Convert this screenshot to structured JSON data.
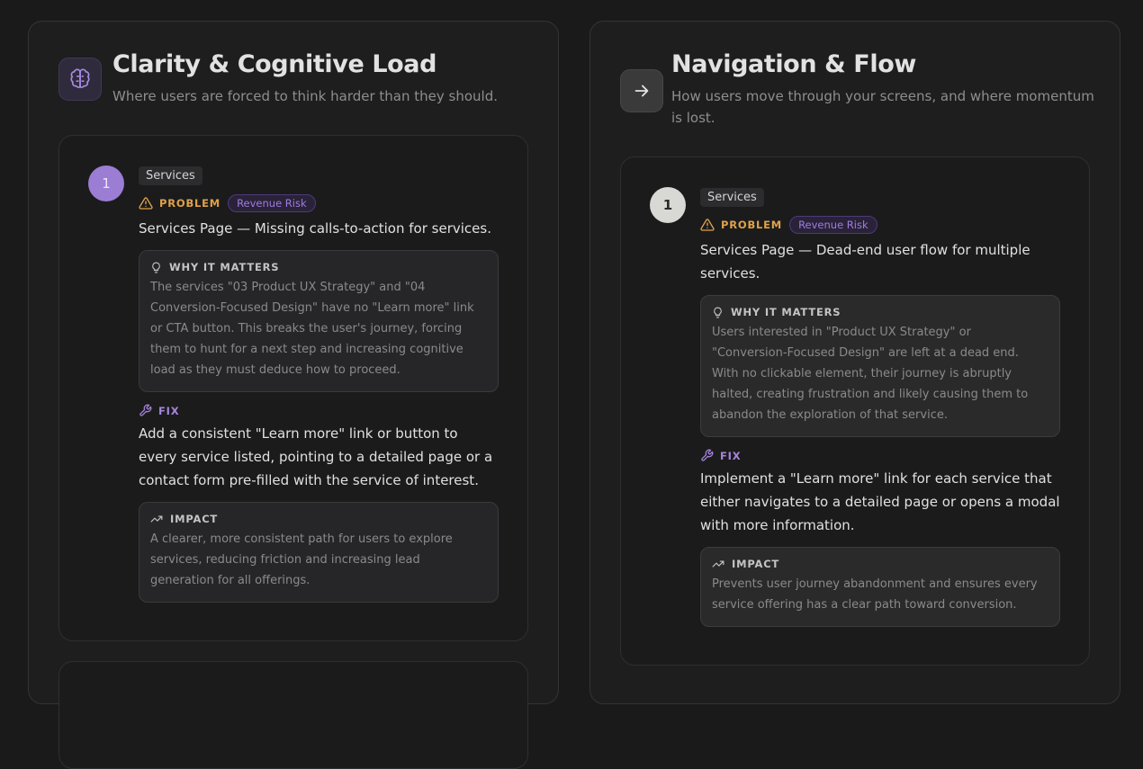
{
  "colors": {
    "accent_purple": "#9b7dd4",
    "problem_amber": "#e0a24a",
    "fix_purple": "#a586dc"
  },
  "categories": [
    {
      "icon": "brain-icon",
      "title": "Clarity & Cognitive Load",
      "subtitle": "Where users are forced to think harder than they should.",
      "issues": [
        {
          "number": "1",
          "tag": "Services",
          "problem_label": "PROBLEM",
          "risk_badge": "Revenue Risk",
          "problem": "Services Page — Missing calls-to-action for services.",
          "why_label": "WHY IT MATTERS",
          "why": "The services \"03 Product UX Strategy\" and \"04 Conversion-Focused Design\" have no \"Learn more\" link or CTA button. This breaks the user's journey, forcing them to hunt for a next step and increasing cognitive load as they must deduce how to proceed.",
          "fix_label": "FIX",
          "fix": "Add a consistent \"Learn more\" link or button to every service listed, pointing to a detailed page or a contact form pre-filled with the service of interest.",
          "impact_label": "IMPACT",
          "impact": "A clearer, more consistent path for users to explore services, reducing friction and increasing lead generation for all offerings."
        }
      ]
    },
    {
      "icon": "arrow-right-icon",
      "title": "Navigation & Flow",
      "subtitle": "How users move through your screens, and where momentum is lost.",
      "issues": [
        {
          "number": "1",
          "tag": "Services",
          "problem_label": "PROBLEM",
          "risk_badge": "Revenue Risk",
          "problem": "Services Page — Dead-end user flow for multiple services.",
          "why_label": "WHY IT MATTERS",
          "why": "Users interested in \"Product UX Strategy\" or \"Conversion-Focused Design\" are left at a dead end. With no clickable element, their journey is abruptly halted, creating frustration and likely causing them to abandon the exploration of that service.",
          "fix_label": "FIX",
          "fix": "Implement a \"Learn more\" link for each service that either navigates to a detailed page or opens a modal with more information.",
          "impact_label": "IMPACT",
          "impact": "Prevents user journey abandonment and ensures every service offering has a clear path toward conversion."
        }
      ]
    }
  ]
}
